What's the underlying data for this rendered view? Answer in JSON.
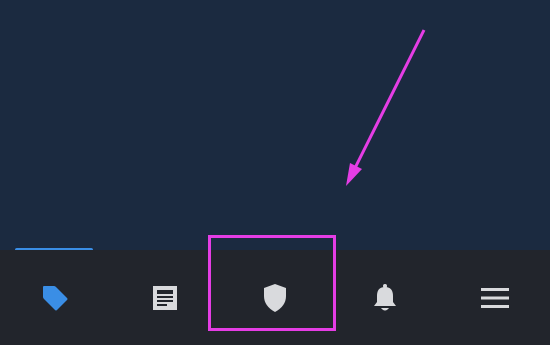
{
  "app": {
    "background_color": "#1b2a40",
    "tabbar_color": "#22252c",
    "accent_color": "#3a8ee6",
    "annotation_color": "#e53de5"
  },
  "tabs": [
    {
      "id": "tags",
      "icon": "tag-icon",
      "active": true,
      "color": "#3a8ee6"
    },
    {
      "id": "news",
      "icon": "newspaper-icon",
      "active": false,
      "color": "#d9dadd"
    },
    {
      "id": "security",
      "icon": "shield-icon",
      "active": false,
      "color": "#d9dadd"
    },
    {
      "id": "notifications",
      "icon": "bell-icon",
      "active": false,
      "color": "#d9dadd"
    },
    {
      "id": "menu",
      "icon": "hamburger-menu-icon",
      "active": false,
      "color": "#d9dadd"
    }
  ],
  "annotation": {
    "target_tab": "security",
    "shape": "rectangle-with-arrow"
  }
}
